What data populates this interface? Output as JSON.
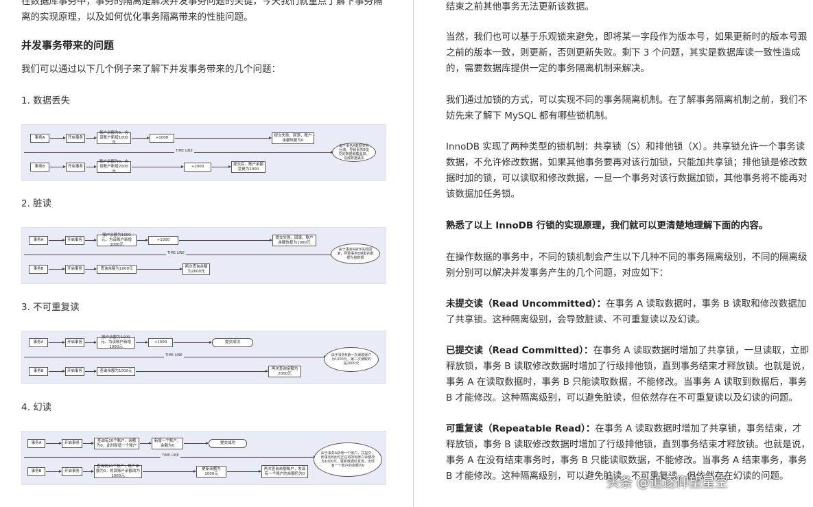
{
  "left": {
    "top_line1": "在数据库事务中，事务的隔离是解决并发事务问题的关键，今天我们就重点了解下事务隔",
    "top_line2": "离的实现原理，以及如何优化事务隔离带来的性能问题。",
    "section_title": "并发事务带来的问题",
    "intro": "我们可以通过以下几个例子来了解下并发事务带来的几个问题：",
    "items": [
      {
        "title": "1. 数据丢失",
        "a": [
          "事务A",
          "开启事务",
          "账户余额为0，方该账户新增1000元",
          "+1000",
          "提交失败，回滚，账户余额恢复为0"
        ],
        "b": [
          "事务B",
          "开启事务",
          "账户余额为0，方该账户新增2000元",
          "+2000",
          "提交后，账户余额变更为2000"
        ],
        "timeline": "TIME LINE",
        "note": "由于事务A数据失败回滚，导致事务B提交的数据被覆盖掉，造成数据丢失"
      },
      {
        "title": "2. 脏读",
        "a": [
          "事务A",
          "开启事务",
          "账户余额为1000元，为该账户新增1000元",
          "+1000",
          "提交失败，回滚，账户余额恢复为1000元"
        ],
        "b": [
          "事务B",
          "开启事务",
          "查询余额为1000元",
          "",
          "两次查询余额为2000元"
        ],
        "timeline": "TIME LINE",
        "note": "由于事务A操作失败回滚，导致事务B读取的数据为脏数据"
      },
      {
        "title": "3. 不可重复读",
        "a": [
          "事务A",
          "开启事务",
          "账户余额为1000元，为该账户新增1000元",
          "+1000",
          "提交成功"
        ],
        "b": [
          "事务B",
          "开启事务",
          "查询余额为1000元",
          "",
          "再次查询余额为2000元"
        ],
        "timeline": "TIME LINE",
        "note": "由于事务B第一次读取账户为1000元，第二次读取的是2000元"
      },
      {
        "title": "4. 幻读",
        "a": [
          "事务A",
          "开启事务",
          "查询有10个账户，余额为0，此时新增一个账户",
          "新增一个账户，余额为0",
          "提交成功"
        ],
        "b": [
          "事务B",
          "开启事务",
          "查询到10个账户，账户余额为0，将其账户余额改为1000元",
          "更新余额为1000元",
          "再次查询余额账户，发现有一个账户的余额仍为0"
        ],
        "timeline": "TIME LINE",
        "note": "由于事务A新增一个账户，并提交，而事务B此时正在将所有账户余额改为1000元，更新数据时发现，出现有一个账户的余额为0"
      }
    ]
  },
  "right": {
    "p1": "结束之前其他事务无法更新该数据。",
    "p2": "当然，我们也可以基于乐观锁来避免，即将某一字段作为版本号，如果更新时的版本号跟之前的版本一致，则更新，否则更新失败。剩下 3 个问题，其实是数据库读一致性造成的，需要数据库提供一定的事务隔离机制来解决。",
    "p3": "我们通过加锁的方式，可以实现不同的事务隔离机制。在了解事务隔离机制之前，我们不妨先来了解下 MySQL 都有哪些锁机制。",
    "p4": "InnoDB 实现了两种类型的锁机制：共享锁（S）和排他锁（X）。共享锁允许一个事务读数据，不允许修改数据，如果其他事务要再对该行加锁，只能加共享锁；排他锁是修改数据时加的锁，可以读取和修改数据，一旦一个事务对该行数据加锁，其他事务将不能再对该数据加任务锁。",
    "p5": "熟悉了以上 InnoDB 行锁的实现原理，我们就可以更清楚地理解下面的内容。",
    "p6": "在操作数据的事务中，不同的锁机制会产生以下几种不同的事务隔离级别，不同的隔离级别分别可以解决并发事务产生的几个问题，对应如下：",
    "p7_label": "未提交读（Read Uncommitted）：",
    "p7": "在事务 A 读取数据时，事务 B 读取和修改数据加了共享锁。这种隔离级别，会导致脏读、不可重复读以及幻读。",
    "p8_label": "已提交读（Read Committed）：",
    "p8": "在事务 A 读取数据时增加了共享锁，一旦读取，立即释放锁，事务 B 读取修改数据时增加了行级排他锁，直到事务结束才释放锁。也就是说，事务 A 在读取数据时，事务 B 只能读取数据，不能修改。当事务 A 读取到数据后，事务 B 才能修改。这种隔离级别，可以避免脏读，但依然存在不可重复读以及幻读的问题。",
    "p9_label": "可重复读（Repeatable Read）：",
    "p9": "在事务 A 读取数据时增加了共享锁，事务结束，才释放锁，事务 B 读取修改数据时增加了行级排他锁，直到事务结束才释放锁。也就是说，事务 A 在没有结束事务时，事务 B 只能读取数据，不能修改。当事务 A 结束事务，事务 B 才能修改。这种隔离级别，可以避免脏读、不可重复读，但依然存在幻读的问题。"
  },
  "watermark": "头条 @追逐仰望星空"
}
